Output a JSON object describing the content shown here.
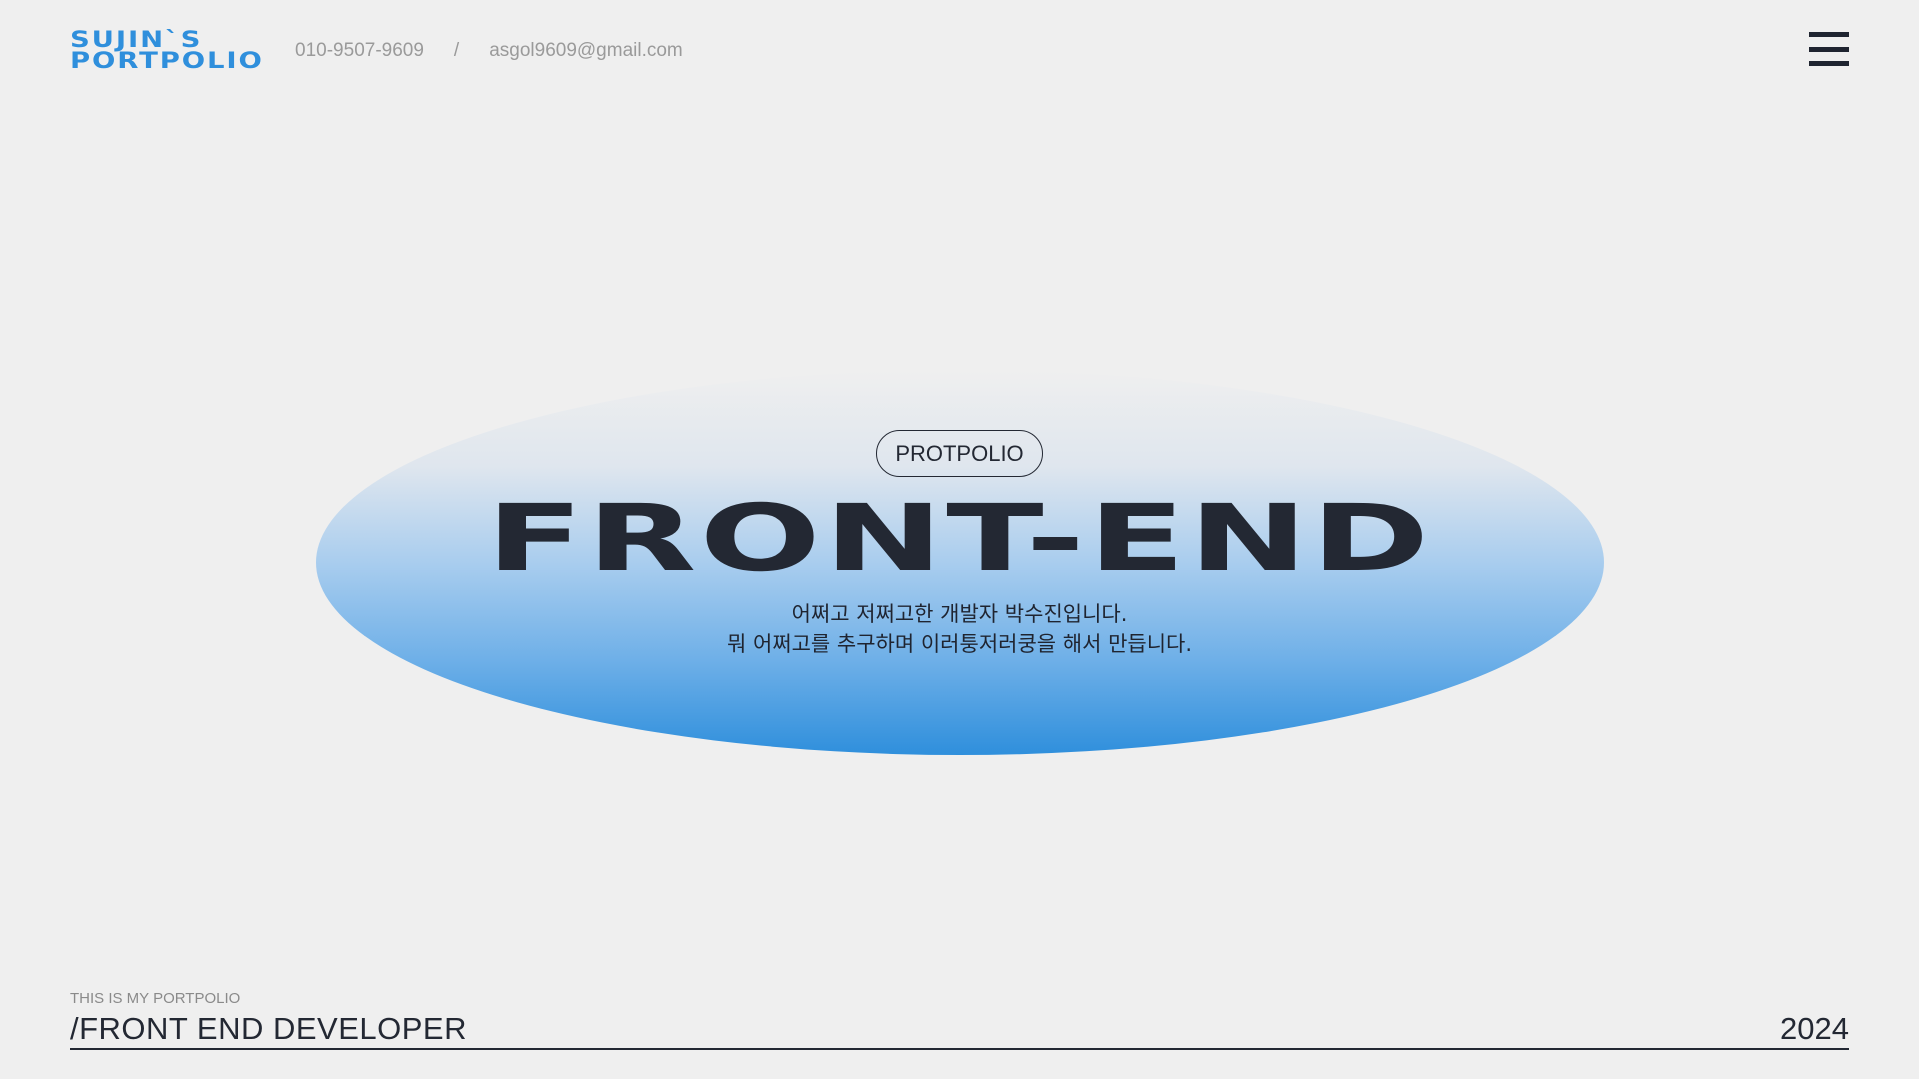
{
  "header": {
    "logo_line1": "SUJIN`S",
    "logo_line2": "PORTPOLIO",
    "phone": "010-9507-9609",
    "separator": "/",
    "email": "asgol9609@gmail.com",
    "menu_icon": "hamburger-menu-icon"
  },
  "hero": {
    "badge": "PROTPOLIO",
    "title": "FRONT-END",
    "desc_line1": "어쩌고 저쩌고한 개발자 박수진입니다.",
    "desc_line2": "뭐 어쩌고를 추구하며 이러퉁저러쿵을 해서 만듭니다."
  },
  "footer": {
    "tagline": "THIS IS MY PORTPOLIO",
    "role": "/FRONT END DEVELOPER",
    "year": "2024"
  },
  "colors": {
    "background": "#efefef",
    "accent_blue": "#2f8fdc",
    "text_dark": "#232833",
    "text_muted": "#9a9a9a"
  }
}
